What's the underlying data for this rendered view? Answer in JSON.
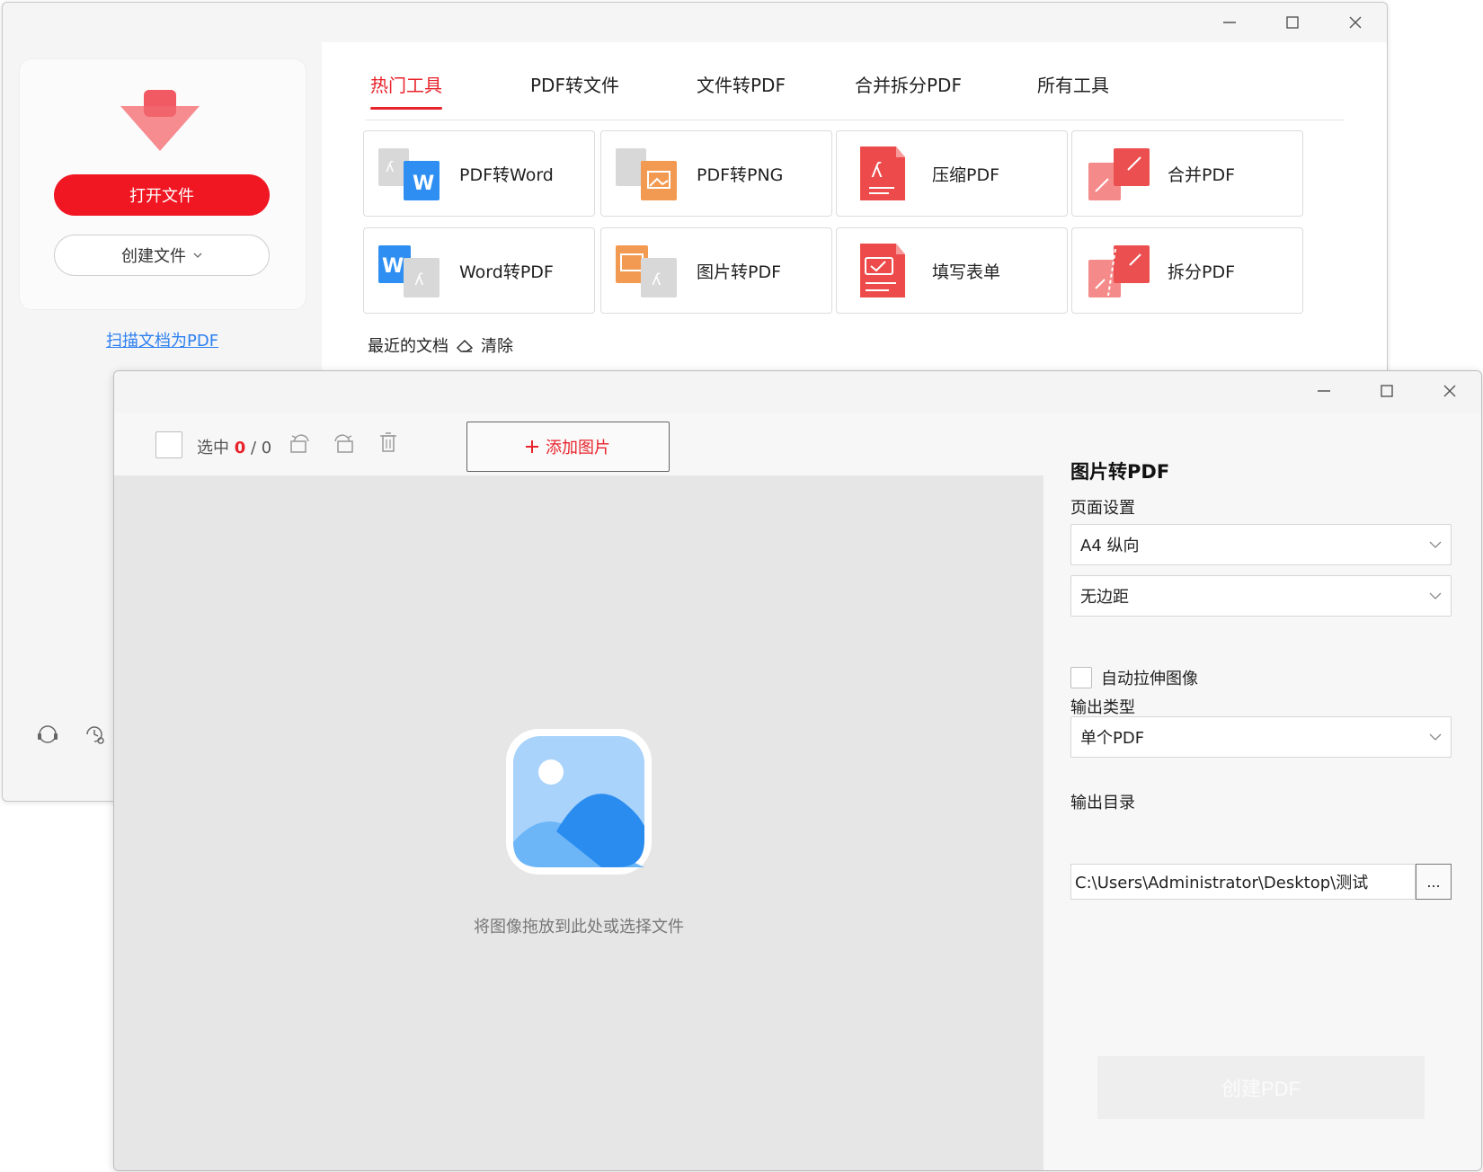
{
  "back_window": {
    "sidebar": {
      "open_button": "打开文件",
      "create_button": "创建文件",
      "scan_link": "扫描文档为PDF"
    },
    "tabs": [
      {
        "label": "热门工具",
        "active": true
      },
      {
        "label": "PDF转文件",
        "active": false
      },
      {
        "label": "文件转PDF",
        "active": false
      },
      {
        "label": "合并拆分PDF",
        "active": false
      },
      {
        "label": "所有工具",
        "active": false
      }
    ],
    "tools": [
      {
        "label": "PDF转Word",
        "icon": "pdf-to-word-icon"
      },
      {
        "label": "PDF转PNG",
        "icon": "pdf-to-png-icon"
      },
      {
        "label": "压缩PDF",
        "icon": "compress-pdf-icon"
      },
      {
        "label": "合并PDF",
        "icon": "merge-pdf-icon"
      },
      {
        "label": "Word转PDF",
        "icon": "word-to-pdf-icon"
      },
      {
        "label": "图片转PDF",
        "icon": "image-to-pdf-icon"
      },
      {
        "label": "填写表单",
        "icon": "fill-form-icon"
      },
      {
        "label": "拆分PDF",
        "icon": "split-pdf-icon"
      }
    ],
    "recent": {
      "label": "最近的文档",
      "clear": "清除"
    },
    "colors": {
      "accent": "#e8232b",
      "link": "#2b7ff0"
    }
  },
  "front_window": {
    "toolbar": {
      "select_prefix": "选中",
      "selected_count": "0",
      "total_sep": "/ 0",
      "add_image_button": "添加图片"
    },
    "dropzone": {
      "hint": "将图像拖放到此处或选择文件"
    },
    "panel": {
      "title": "图片转PDF",
      "page_settings_label": "页面设置",
      "page_size_value": "A4 纵向",
      "margin_value": "无边距",
      "auto_stretch_label": "自动拉伸图像",
      "output_type_label": "输出类型",
      "output_type_value": "单个PDF",
      "output_dir_label": "输出目录",
      "output_dir_value": "C:\\Users\\Administrator\\Desktop\\测试",
      "browse_button": "...",
      "create_button": "创建PDF"
    }
  }
}
